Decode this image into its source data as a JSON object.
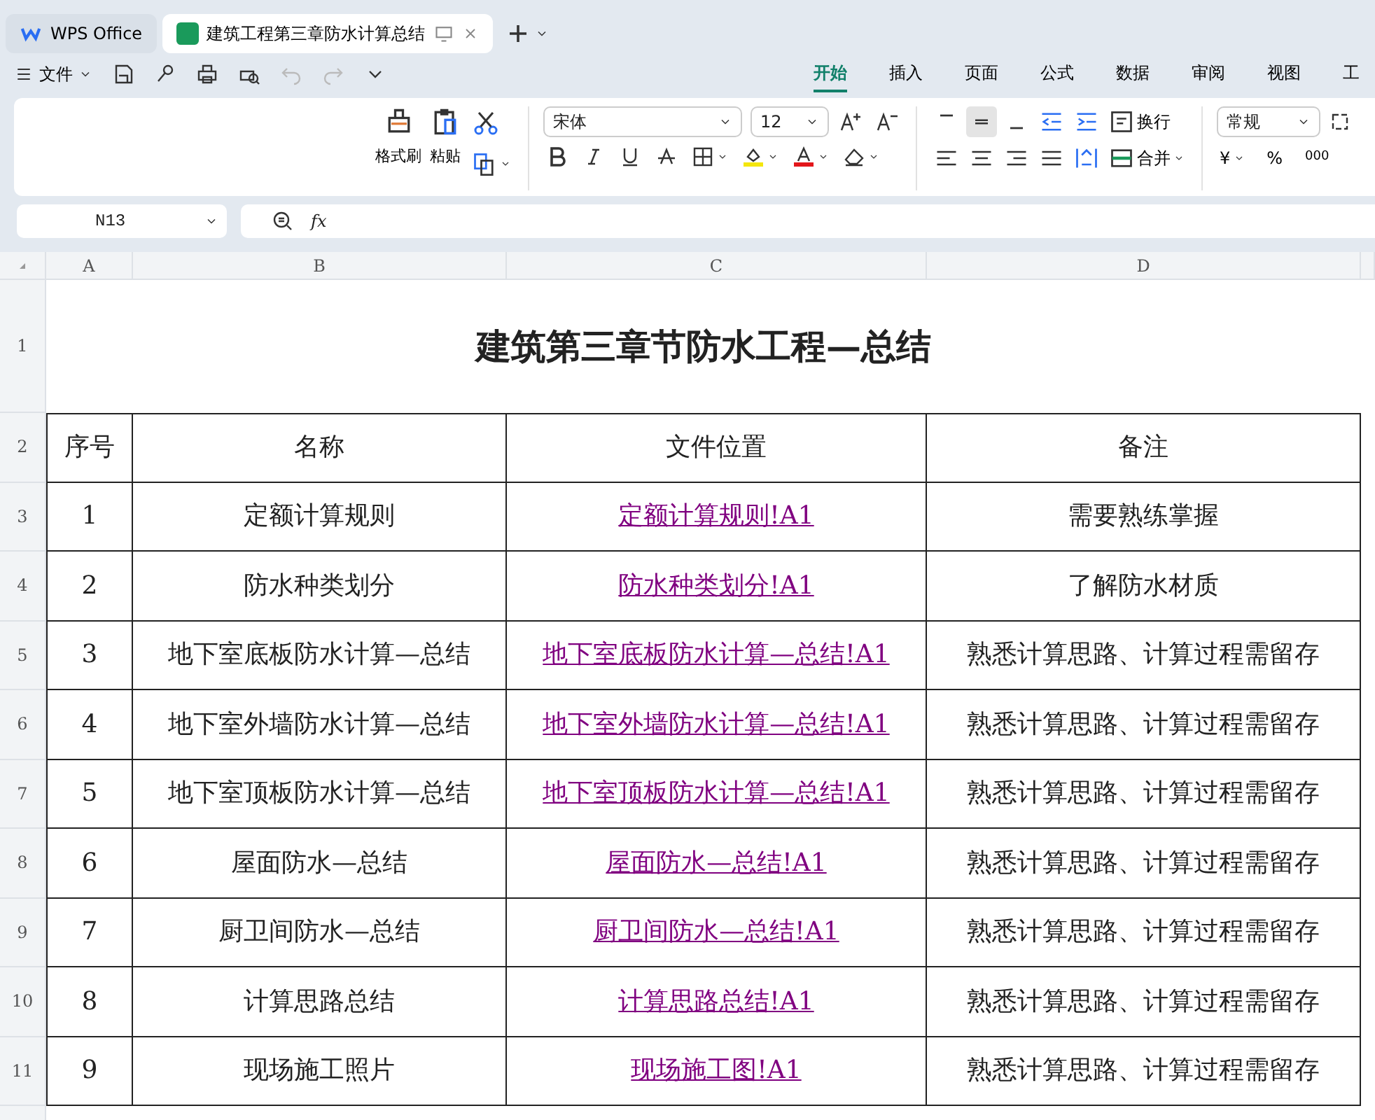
{
  "app_tabs": [
    {
      "label": "WPS Office",
      "kind": "home",
      "selected": false
    },
    {
      "label": "建筑工程第三章防水计算总结",
      "kind": "document",
      "selected": true
    }
  ],
  "quick_access": {
    "file_menu": "文件"
  },
  "ribbon_tabs": [
    {
      "label": "开始",
      "selected": true
    },
    {
      "label": "插入",
      "selected": false
    },
    {
      "label": "页面",
      "selected": false
    },
    {
      "label": "公式",
      "selected": false
    },
    {
      "label": "数据",
      "selected": false
    },
    {
      "label": "审阅",
      "selected": false
    },
    {
      "label": "视图",
      "selected": false
    },
    {
      "label": "工",
      "selected": false
    }
  ],
  "ribbon": {
    "format_painter": "格式刷",
    "paste": "粘贴",
    "font": "宋体",
    "font_size": "12",
    "vertical_align": [
      {
        "selected": false
      },
      {
        "selected": true
      },
      {
        "selected": false
      }
    ],
    "wrap": "换行",
    "merge": "合并",
    "number_format": "常规",
    "currency": "¥",
    "percent": "%",
    "thousands": "000"
  },
  "formula_bar": {
    "name_box": "N13",
    "fx": "fx"
  },
  "sheet": {
    "columns": [
      "A",
      "B",
      "C",
      "D"
    ],
    "row_numbers": [
      "1",
      "2",
      "3",
      "4",
      "5",
      "6",
      "7",
      "8",
      "9",
      "10",
      "11"
    ],
    "title": "建筑第三章节防水工程—总结",
    "header": [
      "序号",
      "名称",
      "文件位置",
      "备注"
    ],
    "rows": [
      {
        "no": "1",
        "name": "定额计算规则",
        "link": "定额计算规则!A1",
        "note": "需要熟练掌握"
      },
      {
        "no": "2",
        "name": "防水种类划分",
        "link": "防水种类划分!A1",
        "note": "了解防水材质"
      },
      {
        "no": "3",
        "name": "地下室底板防水计算—总结",
        "link": "地下室底板防水计算—总结!A1",
        "note": "熟悉计算思路、计算过程需留存"
      },
      {
        "no": "4",
        "name": "地下室外墙防水计算—总结",
        "link": "地下室外墙防水计算—总结!A1",
        "note": "熟悉计算思路、计算过程需留存"
      },
      {
        "no": "5",
        "name": "地下室顶板防水计算—总结",
        "link": "地下室顶板防水计算—总结!A1",
        "note": "熟悉计算思路、计算过程需留存"
      },
      {
        "no": "6",
        "name": "屋面防水—总结",
        "link": "屋面防水—总结!A1",
        "note": "熟悉计算思路、计算过程需留存"
      },
      {
        "no": "7",
        "name": "厨卫间防水—总结",
        "link": "厨卫间防水—总结!A1",
        "note": "熟悉计算思路、计算过程需留存"
      },
      {
        "no": "8",
        "name": "计算思路总结",
        "link": "计算思路总结!A1",
        "note": "熟悉计算思路、计算过程需留存"
      },
      {
        "no": "9",
        "name": "现场施工照片",
        "link": "现场施工图!A1",
        "note": "熟悉计算思路、计算过程需留存"
      }
    ]
  }
}
